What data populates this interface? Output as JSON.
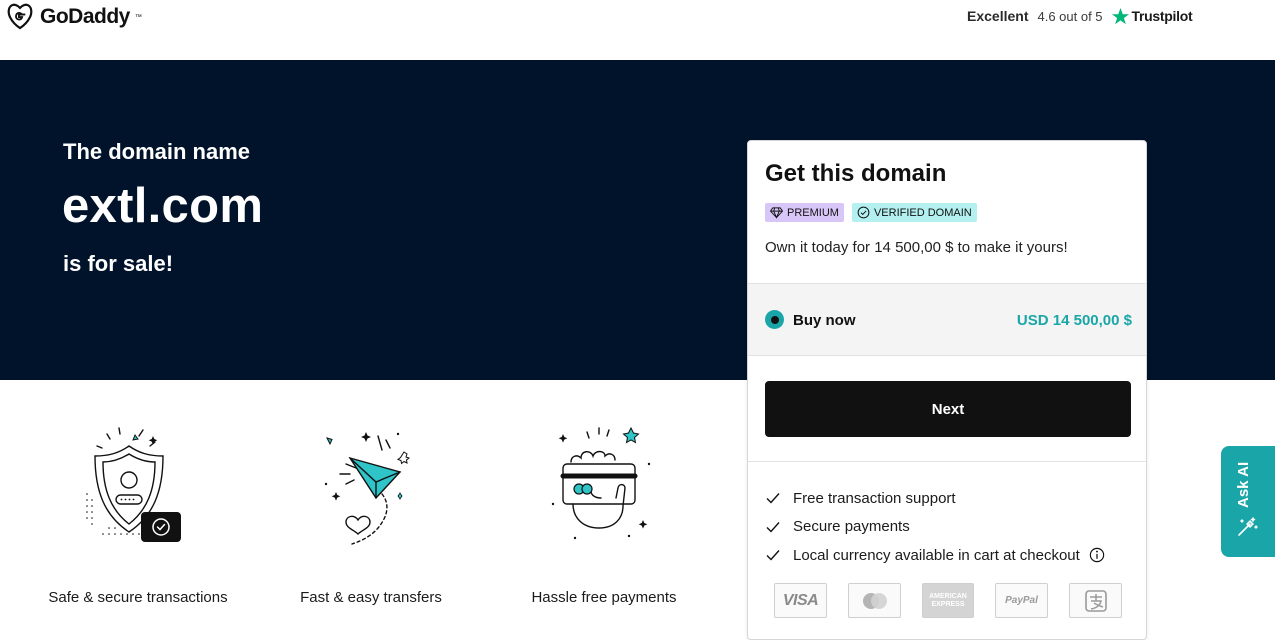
{
  "header": {
    "logo_text": "GoDaddy",
    "logo_tm": "™",
    "trustpilot": {
      "excellent": "Excellent",
      "rating": "4.6 out of 5",
      "brand": "Trustpilot",
      "star_color": "#00b67a"
    }
  },
  "hero": {
    "pre_text": "The domain name",
    "domain": "extl.com",
    "post_text": "is for sale!",
    "background_color": "#00132b"
  },
  "features": [
    {
      "label": "Safe & secure transactions",
      "icon": "shield-user-icon"
    },
    {
      "label": "Fast & easy transfers",
      "icon": "paper-plane-icon"
    },
    {
      "label": "Hassle free payments",
      "icon": "hand-card-icon"
    }
  ],
  "purchase_card": {
    "title": "Get this domain",
    "badges": [
      {
        "label": "PREMIUM",
        "icon": "diamond-icon",
        "color": "#d9c6f8"
      },
      {
        "label": "VERIFIED DOMAIN",
        "icon": "check-circle-icon",
        "color": "#b4f0f0"
      }
    ],
    "subtitle": "Own it today for 14 500,00 $ to make it yours!",
    "option": {
      "label": "Buy now",
      "price": "USD 14 500,00 $",
      "selected": true
    },
    "next_label": "Next",
    "benefits": [
      "Free transaction support",
      "Secure payments",
      "Local currency available in cart at checkout"
    ],
    "payment_methods": [
      "VISA",
      "Mastercard",
      "AMERICAN EXPRESS",
      "PayPal",
      "Alipay"
    ],
    "accent_color": "#1aa6a8"
  },
  "ask_ai": {
    "label": "Ask AI",
    "icon": "magic-wand-icon"
  }
}
